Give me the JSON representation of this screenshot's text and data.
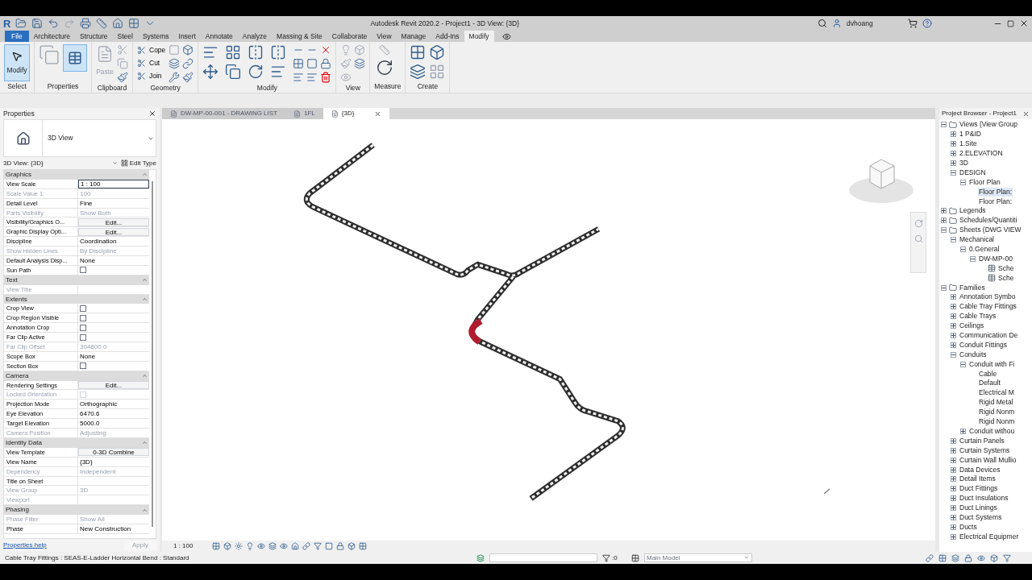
{
  "window": {
    "logo": "R",
    "title": "Autodesk Revit 2020.2 - Project1 - 3D View: {3D}",
    "user": "dvhoang"
  },
  "ribbon_tabs": [
    {
      "label": "File",
      "kind": "file",
      "selected": false
    },
    {
      "label": "Architecture",
      "kind": "tab",
      "selected": false
    },
    {
      "label": "Structure",
      "kind": "tab",
      "selected": false
    },
    {
      "label": "Steel",
      "kind": "tab",
      "selected": false
    },
    {
      "label": "Systems",
      "kind": "tab",
      "selected": false
    },
    {
      "label": "Insert",
      "kind": "tab",
      "selected": false
    },
    {
      "label": "Annotate",
      "kind": "tab",
      "selected": false
    },
    {
      "label": "Analyze",
      "kind": "tab",
      "selected": false
    },
    {
      "label": "Massing & Site",
      "kind": "tab",
      "selected": false
    },
    {
      "label": "Collaborate",
      "kind": "tab",
      "selected": false
    },
    {
      "label": "View",
      "kind": "tab",
      "selected": false
    },
    {
      "label": "Manage",
      "kind": "tab",
      "selected": false
    },
    {
      "label": "Add-Ins",
      "kind": "tab",
      "selected": false
    },
    {
      "label": "Modify",
      "kind": "tab",
      "selected": true
    }
  ],
  "ribbon_panels": [
    {
      "kind": "select",
      "label": "Select",
      "tools": [
        {
          "label": "Modify",
          "selected": true
        }
      ]
    },
    {
      "kind": "properties",
      "label": "Properties"
    },
    {
      "kind": "clipboard",
      "label": "Clipboard",
      "tools": [
        {
          "label": "Paste",
          "disabled": true
        }
      ]
    },
    {
      "kind": "geometry",
      "label": "Geometry",
      "tools": [
        {
          "label": "Cope",
          "disabled": false
        },
        {
          "label": "Cut",
          "disabled": false
        },
        {
          "label": "Join",
          "disabled": false
        }
      ]
    },
    {
      "kind": "modify",
      "label": "Modify"
    },
    {
      "kind": "view",
      "label": "View"
    },
    {
      "kind": "measure",
      "label": "Measure"
    },
    {
      "kind": "create",
      "label": "Create"
    }
  ],
  "properties": {
    "title": "Properties",
    "type_name": "3D View",
    "selector": "3D View: {3D}",
    "edit_type": "Edit Type",
    "groups": [
      {
        "name": "Graphics",
        "rows": [
          {
            "label": "View Scale",
            "value": "1 : 100",
            "kind": "field",
            "disabled": false
          },
          {
            "label": "Scale Value    1:",
            "value": "100",
            "kind": "text",
            "disabled": true
          },
          {
            "label": "Detail Level",
            "value": "Fine",
            "kind": "text",
            "disabled": false
          },
          {
            "label": "Parts Visibility",
            "value": "Show Both",
            "kind": "text",
            "disabled": true
          },
          {
            "label": "Visibility/Graphics O...",
            "value": "Edit...",
            "kind": "button",
            "disabled": false
          },
          {
            "label": "Graphic Display Opti...",
            "value": "Edit...",
            "kind": "button",
            "disabled": false
          },
          {
            "label": "Discipline",
            "value": "Coordination",
            "kind": "text",
            "disabled": false
          },
          {
            "label": "Show Hidden Lines",
            "value": "By Discipline",
            "kind": "text",
            "disabled": true
          },
          {
            "label": "Default Analysis Disp...",
            "value": "None",
            "kind": "text",
            "disabled": false
          },
          {
            "label": "Sun Path",
            "kind": "checkbox",
            "checked": false,
            "disabled": false
          }
        ]
      },
      {
        "name": "Text",
        "rows": [
          {
            "label": "View Title",
            "kind": "text",
            "disabled": true
          }
        ]
      },
      {
        "name": "Extents",
        "rows": [
          {
            "label": "Crop View",
            "kind": "checkbox",
            "checked": false,
            "disabled": false
          },
          {
            "label": "Crop Region Visible",
            "kind": "checkbox",
            "checked": false,
            "disabled": false
          },
          {
            "label": "Annotation Crop",
            "kind": "checkbox",
            "checked": false,
            "disabled": false
          },
          {
            "label": "Far Clip Active",
            "kind": "checkbox",
            "checked": false,
            "disabled": false
          },
          {
            "label": "Far Clip Offset",
            "value": "304800.0",
            "kind": "text",
            "disabled": true
          },
          {
            "label": "Scope Box",
            "value": "None",
            "kind": "text",
            "disabled": false
          },
          {
            "label": "Section Box",
            "kind": "checkbox",
            "checked": false,
            "disabled": false
          }
        ]
      },
      {
        "name": "Camera",
        "rows": [
          {
            "label": "Rendering Settings",
            "value": "Edit...",
            "kind": "button",
            "disabled": false
          },
          {
            "label": "Locked Orientation",
            "kind": "checkbox",
            "checked": false,
            "disabled": true
          },
          {
            "label": "Projection Mode",
            "value": "Orthographic",
            "kind": "text",
            "disabled": false
          },
          {
            "label": "Eye Elevation",
            "value": "6470.6",
            "kind": "text",
            "disabled": false
          },
          {
            "label": "Target Elevation",
            "value": "5000.0",
            "kind": "text",
            "disabled": false
          },
          {
            "label": "Camera Position",
            "value": "Adjusting",
            "kind": "text",
            "disabled": true
          }
        ]
      },
      {
        "name": "Identity Data",
        "rows": [
          {
            "label": "View Template",
            "value": "0-3D Combine",
            "kind": "button",
            "disabled": false
          },
          {
            "label": "View Name",
            "value": "{3D}",
            "kind": "text",
            "disabled": false
          },
          {
            "label": "Dependency",
            "value": "Independent",
            "kind": "text",
            "disabled": true
          },
          {
            "label": "Title on Sheet",
            "kind": "text",
            "disabled": false
          },
          {
            "label": "View Group",
            "value": "3D",
            "kind": "text",
            "disabled": true
          },
          {
            "label": "Viewport",
            "kind": "text",
            "disabled": true
          }
        ]
      },
      {
        "name": "Phasing",
        "rows": [
          {
            "label": "Phase Filter",
            "value": "Show All",
            "kind": "text",
            "disabled": true
          },
          {
            "label": "Phase",
            "value": "New Construction",
            "kind": "text",
            "disabled": false
          }
        ]
      }
    ],
    "help": "Properties help",
    "apply": "Apply"
  },
  "view_tabs": [
    {
      "label": "DW-MP-00-001 - DRAWING LIST",
      "selected": false
    },
    {
      "label": "1FL",
      "selected": false
    },
    {
      "label": "{3D}",
      "selected": true
    }
  ],
  "view_scale": "1 : 100",
  "browser": {
    "title": "Project Browser - Project1",
    "tree": [
      {
        "label": "Views (View Group",
        "expanded": true,
        "selected": false,
        "children": [
          {
            "label": "1 P&ID",
            "expanded": false,
            "selected": false
          },
          {
            "label": "1.Site",
            "expanded": false,
            "selected": false
          },
          {
            "label": "2.ELEVATION",
            "expanded": false,
            "selected": false
          },
          {
            "label": "3D",
            "expanded": false,
            "selected": false
          },
          {
            "label": "DESIGN",
            "expanded": true,
            "selected": false,
            "children": [
              {
                "label": "Floor Plan",
                "expanded": true,
                "selected": false,
                "children": [
                  {
                    "label": "Floor Plan:",
                    "selected": true
                  },
                  {
                    "label": "Floor Plan:",
                    "selected": false
                  }
                ]
              }
            ]
          }
        ]
      },
      {
        "label": "Legends",
        "expanded": false,
        "selected": false
      },
      {
        "label": "Schedules/Quantiti",
        "expanded": false,
        "selected": false
      },
      {
        "label": "Sheets (DWG VIEW",
        "expanded": true,
        "selected": false,
        "children": [
          {
            "label": "Mechanical",
            "expanded": true,
            "selected": false,
            "children": [
              {
                "label": "0.General",
                "expanded": true,
                "selected": false,
                "children": [
                  {
                    "label": "DW-MP-00",
                    "expanded": true,
                    "selected": false,
                    "children": [
                      {
                        "label": "Sche",
                        "selected": false
                      },
                      {
                        "label": "Sche",
                        "selected": false
                      }
                    ]
                  }
                ]
              }
            ]
          }
        ]
      },
      {
        "label": "Families",
        "expanded": true,
        "selected": false,
        "children": [
          {
            "label": "Annotation Symbo",
            "expanded": false,
            "selected": false
          },
          {
            "label": "Cable Tray Fittings",
            "expanded": false,
            "selected": false
          },
          {
            "label": "Cable Trays",
            "expanded": false,
            "selected": false
          },
          {
            "label": "Ceilings",
            "expanded": false,
            "selected": false
          },
          {
            "label": "Communication De",
            "expanded": false,
            "selected": false
          },
          {
            "label": "Conduit Fittings",
            "expanded": false,
            "selected": false
          },
          {
            "label": "Conduits",
            "expanded": true,
            "selected": false,
            "children": [
              {
                "label": "Conduit with Fi",
                "expanded": true,
                "selected": false,
                "children": [
                  {
                    "label": "Cable",
                    "selected": false
                  },
                  {
                    "label": "Default",
                    "selected": false
                  },
                  {
                    "label": "Electrical M",
                    "selected": false
                  },
                  {
                    "label": "Rigid Metal",
                    "selected": false
                  },
                  {
                    "label": "Rigid Nonm",
                    "selected": false
                  },
                  {
                    "label": "Rigid Nonm",
                    "selected": false
                  }
                ]
              },
              {
                "label": "Conduit withou",
                "expanded": false,
                "selected": false
              }
            ]
          },
          {
            "label": "Curtain Panels",
            "expanded": false,
            "selected": false
          },
          {
            "label": "Curtain Systems",
            "expanded": false,
            "selected": false
          },
          {
            "label": "Curtain Wall Mullio",
            "expanded": false,
            "selected": false
          },
          {
            "label": "Data Devices",
            "expanded": false,
            "selected": false
          },
          {
            "label": "Detail Items",
            "expanded": false,
            "selected": false
          },
          {
            "label": "Duct Fittings",
            "expanded": false,
            "selected": false
          },
          {
            "label": "Duct Insulations",
            "expanded": false,
            "selected": false
          },
          {
            "label": "Duct Linings",
            "expanded": false,
            "selected": false
          },
          {
            "label": "Duct Systems",
            "expanded": false,
            "selected": false
          },
          {
            "label": "Ducts",
            "expanded": false,
            "selected": false
          },
          {
            "label": "Electrical Equipmer",
            "expanded": false,
            "selected": false
          }
        ]
      }
    ]
  },
  "status_bar": {
    "message": "Cable Tray Fittings : SEAS-E-Ladder Horizontal Bend : Standard",
    "count": ":0",
    "model": "Main Model"
  }
}
